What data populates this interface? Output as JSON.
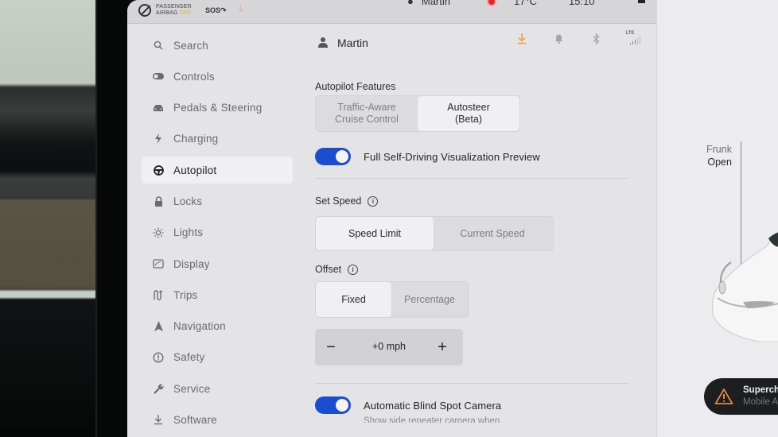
{
  "status_bar": {
    "airbag_line1": "PASSENGER",
    "airbag_line2": "AIRBAG",
    "airbag_state": "OFF",
    "sos": "SOS",
    "user": "Martin",
    "temperature": "17°C",
    "time": "15:10"
  },
  "sidebar": {
    "items": [
      {
        "label": "Search",
        "icon": "search-icon",
        "active": false
      },
      {
        "label": "Controls",
        "icon": "toggle-icon",
        "active": false
      },
      {
        "label": "Pedals & Steering",
        "icon": "car-icon",
        "active": false
      },
      {
        "label": "Charging",
        "icon": "lightning-icon",
        "active": false
      },
      {
        "label": "Autopilot",
        "icon": "steering-wheel-icon",
        "active": true
      },
      {
        "label": "Locks",
        "icon": "lock-icon",
        "active": false
      },
      {
        "label": "Lights",
        "icon": "sun-icon",
        "active": false
      },
      {
        "label": "Display",
        "icon": "display-icon",
        "active": false
      },
      {
        "label": "Trips",
        "icon": "trips-icon",
        "active": false
      },
      {
        "label": "Navigation",
        "icon": "navigation-arrow-icon",
        "active": false
      },
      {
        "label": "Safety",
        "icon": "alert-circle-icon",
        "active": false
      },
      {
        "label": "Service",
        "icon": "wrench-icon",
        "active": false
      },
      {
        "label": "Software",
        "icon": "download-icon",
        "active": false
      }
    ]
  },
  "header": {
    "user_name": "Martin",
    "icons": [
      "download-icon",
      "bell-icon",
      "bluetooth-icon",
      "lte-signal-icon"
    ],
    "lte_label": "LTE"
  },
  "autopilot": {
    "features_label": "Autopilot Features",
    "features_options": [
      {
        "label_line1": "Traffic-Aware",
        "label_line2": "Cruise Control",
        "selected": false
      },
      {
        "label_line1": "Autosteer",
        "label_line2": "(Beta)",
        "selected": true
      }
    ],
    "fsd_preview_label": "Full Self-Driving Visualization Preview",
    "fsd_preview_on": true,
    "set_speed_label": "Set Speed",
    "set_speed_options": [
      {
        "label": "Speed Limit",
        "selected": true
      },
      {
        "label": "Current Speed",
        "selected": false
      }
    ],
    "offset_label": "Offset",
    "offset_options": [
      {
        "label": "Fixed",
        "selected": true
      },
      {
        "label": "Percentage",
        "selected": false
      }
    ],
    "offset_minus": "−",
    "offset_value": "+0 mph",
    "offset_plus": "+",
    "blind_spot_label": "Automatic Blind Spot Camera",
    "blind_spot_on": true,
    "blind_spot_sub": "Show side repeater camera when..."
  },
  "car_panel": {
    "frunk_label": "Frunk",
    "frunk_state": "Open",
    "alert_title": "Superchar...",
    "alert_sub": "Mobile A..."
  },
  "colors": {
    "accent_blue": "#1b4dd0",
    "download_orange": "#f0a24e",
    "alert_orange": "#e0893a"
  }
}
